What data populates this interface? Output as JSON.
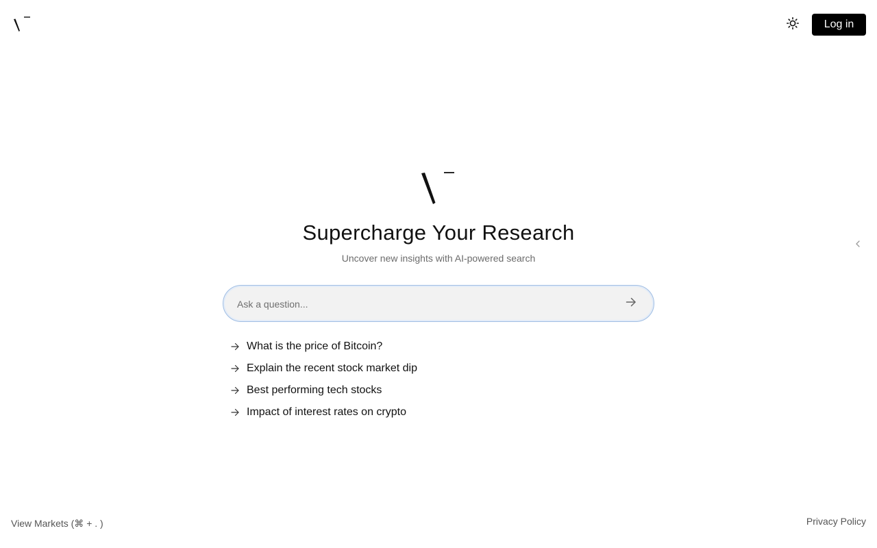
{
  "header": {
    "logo_icon": "vector-v-logo-icon",
    "theme_icon": "sun-icon",
    "login_label": "Log in"
  },
  "hero": {
    "logo_icon": "vector-v-logo-icon",
    "title": "Supercharge Your Research",
    "subtitle": "Uncover new insights with AI-powered search"
  },
  "search": {
    "placeholder": "Ask a question...",
    "value": "",
    "submit_icon": "arrow-right-icon"
  },
  "suggestions": [
    {
      "label": "What is the price of Bitcoin?",
      "icon": "arrow-right-icon"
    },
    {
      "label": "Explain the recent stock market dip",
      "icon": "arrow-right-icon"
    },
    {
      "label": "Best performing tech stocks",
      "icon": "arrow-right-icon"
    },
    {
      "label": "Impact of interest rates on crypto",
      "icon": "arrow-right-icon"
    }
  ],
  "side_panel": {
    "collapse_icon": "chevron-left-icon"
  },
  "footer": {
    "markets_label": "View Markets (⌘ + . )",
    "privacy_label": "Privacy Policy"
  },
  "colors": {
    "accent": "#000000",
    "search_border": "#9fbde3",
    "search_bg": "#f2f2f2",
    "muted_text": "#6b6b6b"
  }
}
